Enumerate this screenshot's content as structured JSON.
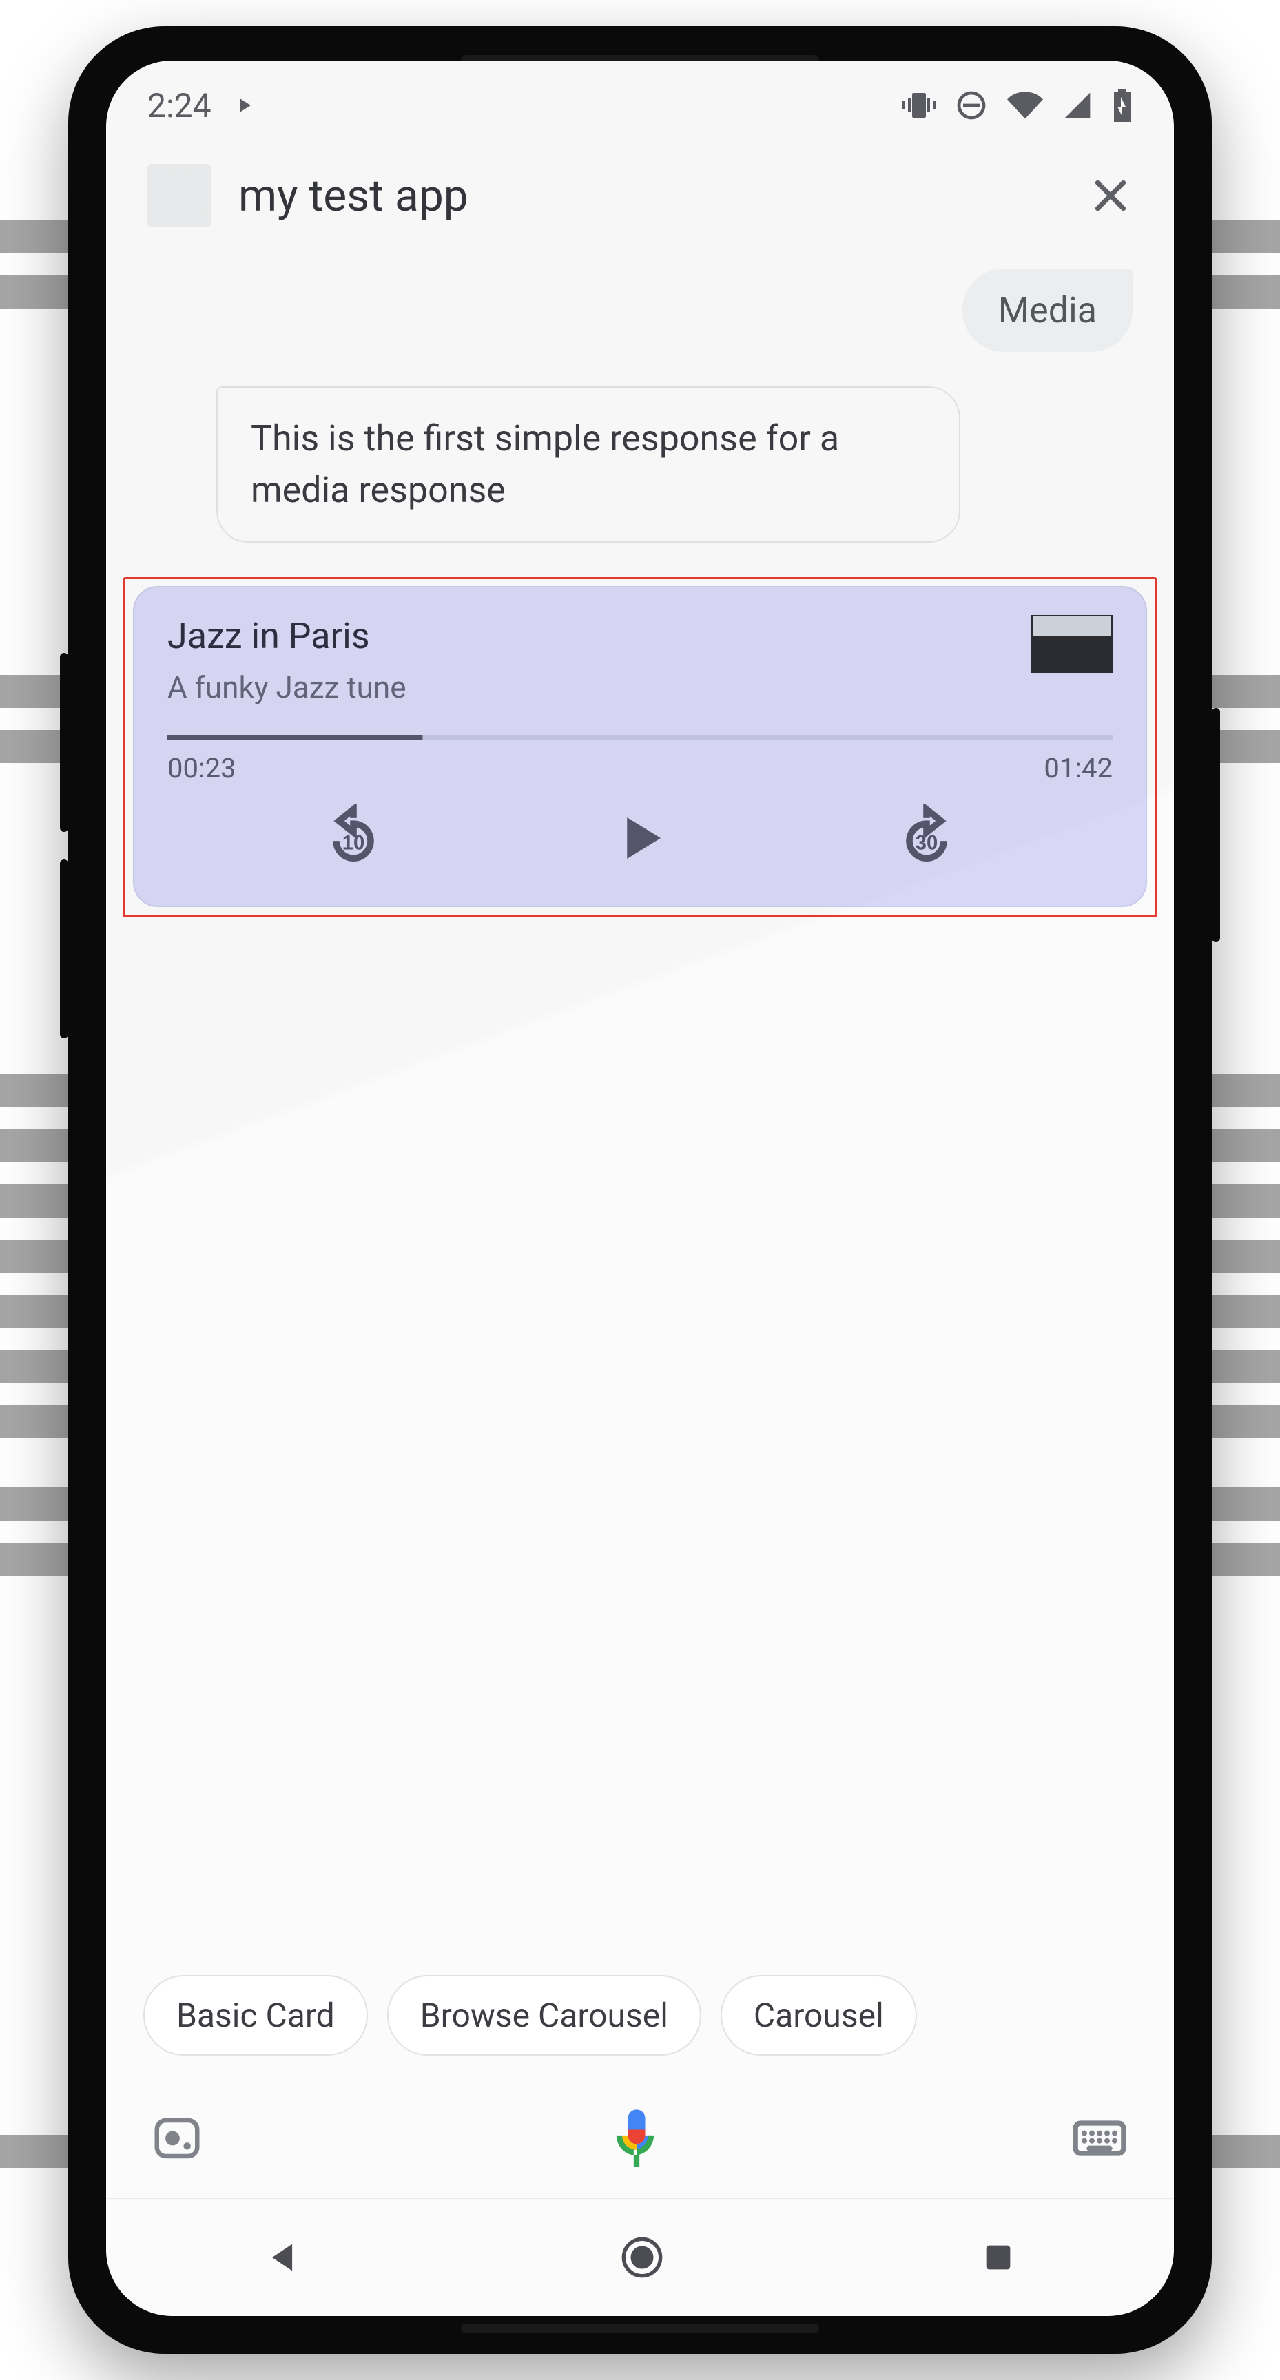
{
  "statusbar": {
    "time": "2:24"
  },
  "header": {
    "app_name": "my test app"
  },
  "conversation": {
    "user_chip": "Media",
    "bot_bubble": "This is the first simple response for a media response"
  },
  "media": {
    "title": "Jazz in Paris",
    "subtitle": "A funky Jazz tune",
    "elapsed": "00:23",
    "duration": "01:42",
    "progress_pct": 27,
    "rewind_seconds": "10",
    "forward_seconds": "30"
  },
  "suggestions": {
    "chips": [
      "Basic Card",
      "Browse Carousel",
      "Carousel"
    ]
  }
}
